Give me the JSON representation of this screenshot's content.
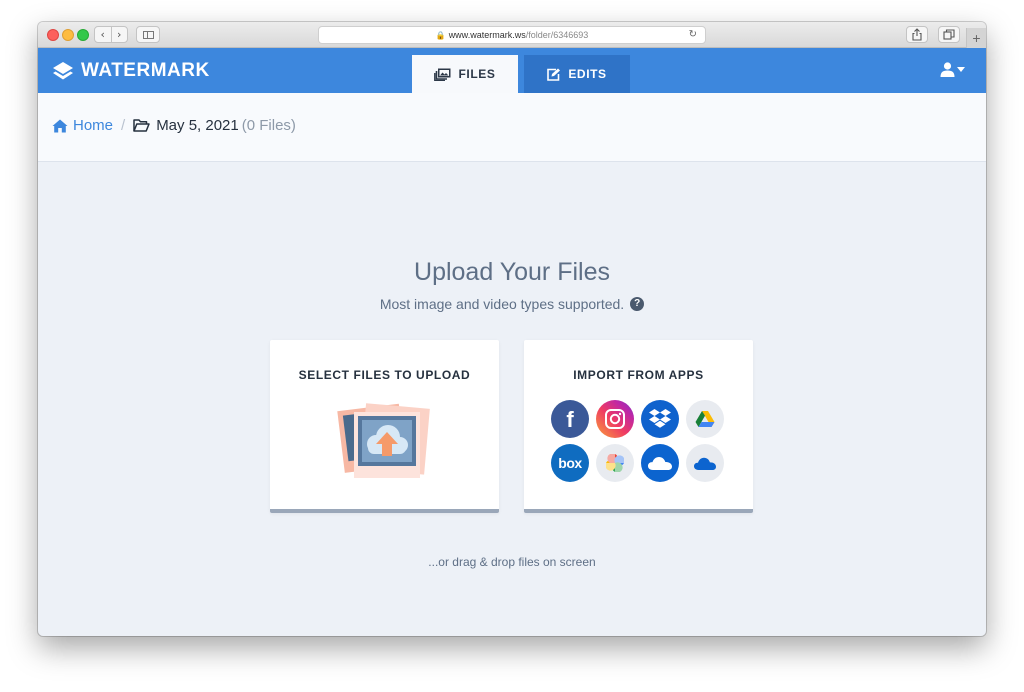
{
  "browser": {
    "url_domain": "www.watermark.ws",
    "url_path": "/folder/6346693",
    "back_glyph": "‹",
    "forward_glyph": "›",
    "reload_glyph": "↻",
    "new_tab_glyph": "+"
  },
  "header": {
    "brand": "WATERMARK",
    "tabs": [
      {
        "label": "FILES",
        "icon": "images-icon",
        "active": true
      },
      {
        "label": "EDITS",
        "icon": "edit-icon",
        "active": false
      }
    ],
    "user_icon": "user-icon"
  },
  "breadcrumb": {
    "home": "Home",
    "separator": "/",
    "folder": "May 5, 2021",
    "count": "(0 Files)"
  },
  "upload": {
    "title": "Upload Your Files",
    "subtitle": "Most image and video types supported.",
    "help_glyph": "?",
    "select_card_title": "SELECT FILES TO UPLOAD",
    "import_card_title": "IMPORT FROM APPS",
    "apps": [
      "facebook",
      "instagram",
      "dropbox",
      "google-drive",
      "box",
      "google-photos",
      "onedrive",
      "onedrive"
    ],
    "facebook_glyph": "f",
    "box_text": "box",
    "drag_hint": "...or drag & drop files on screen"
  },
  "colors": {
    "brand_blue": "#3d87dd",
    "active_tab_bg": "#f7f9fc",
    "inactive_tab_bg": "#2f73c7",
    "page_bg": "#edf1f7",
    "muted_text": "#5e6f86"
  }
}
